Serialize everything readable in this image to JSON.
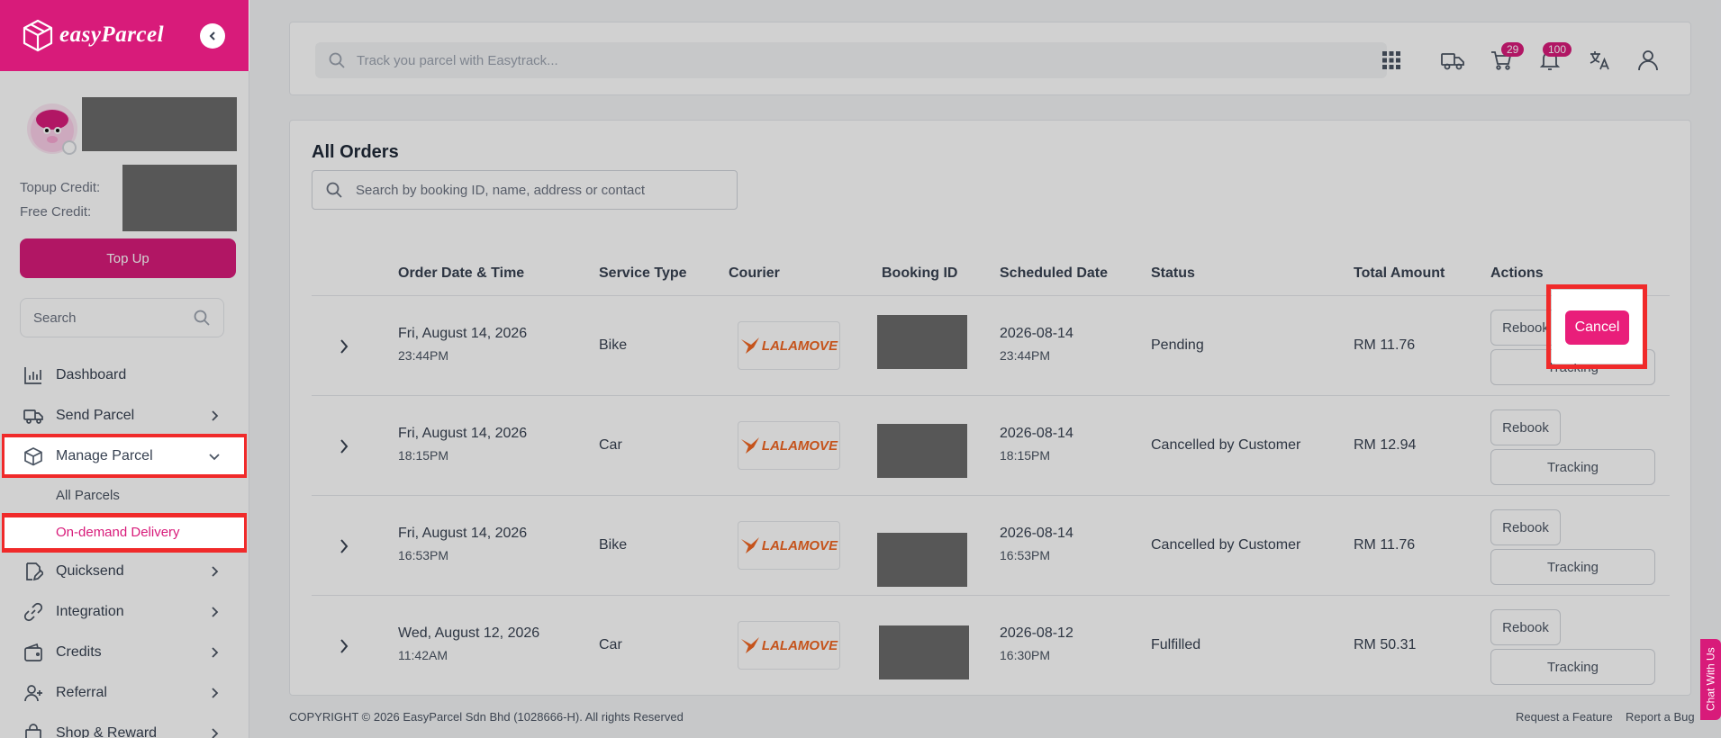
{
  "brand": {
    "name": "easyParcel"
  },
  "sidebar": {
    "topup_credit_label": "Topup Credit:",
    "free_credit_label": "Free Credit:",
    "topup_button": "Top Up",
    "search_placeholder": "Search",
    "items": [
      {
        "label": "Dashboard",
        "icon": "chart-icon"
      },
      {
        "label": "Send Parcel",
        "icon": "truck-icon"
      },
      {
        "label": "Manage Parcel",
        "icon": "box-icon"
      },
      {
        "label": "Quicksend",
        "icon": "edit-icon"
      },
      {
        "label": "Integration",
        "icon": "link-icon"
      },
      {
        "label": "Credits",
        "icon": "wallet-icon"
      },
      {
        "label": "Referral",
        "icon": "user-plus-icon"
      },
      {
        "label": "Shop & Reward",
        "icon": "shopping-bag-icon"
      }
    ],
    "sub_items": [
      {
        "label": "All Parcels"
      },
      {
        "label": "On-demand Delivery"
      }
    ]
  },
  "topbar": {
    "track_placeholder": "Track you parcel with Easytrack...",
    "cart_count": "29",
    "notification_count": "100"
  },
  "orders": {
    "title": "All Orders",
    "search_placeholder": "Search by booking ID, name, address or contact",
    "columns": [
      "Order Date & Time",
      "Service Type",
      "Courier",
      "Booking ID",
      "Scheduled Date",
      "Status",
      "Total Amount",
      "Actions"
    ],
    "rows": [
      {
        "date": "Fri, August 14, 2026",
        "time": "23:44PM",
        "service": "Bike",
        "courier": "LALAMOVE",
        "sched_date": "2026-08-14",
        "sched_time": "23:44PM",
        "status": "Pending",
        "amount": "RM 11.76"
      },
      {
        "date": "Fri, August 14, 2026",
        "time": "18:15PM",
        "service": "Car",
        "courier": "LALAMOVE",
        "sched_date": "2026-08-14",
        "sched_time": "18:15PM",
        "status": "Cancelled by Customer",
        "amount": "RM 12.94"
      },
      {
        "date": "Fri, August 14, 2026",
        "time": "16:53PM",
        "service": "Bike",
        "courier": "LALAMOVE",
        "sched_date": "2026-08-14",
        "sched_time": "16:53PM",
        "status": "Cancelled by Customer",
        "amount": "RM 11.76"
      },
      {
        "date": "Wed, August 12, 2026",
        "time": "11:42AM",
        "service": "Car",
        "courier": "LALAMOVE",
        "sched_date": "2026-08-12",
        "sched_time": "16:30PM",
        "status": "Fulfilled",
        "amount": "RM 50.31"
      }
    ],
    "rebook_label": "Rebook",
    "tracking_label": "Tracking",
    "cancel_label": "Cancel"
  },
  "footer": {
    "copyright": "COPYRIGHT © 2026 EasyParcel Sdn Bhd (1028666-H). All rights Reserved",
    "request_feature": "Request a Feature",
    "report_bug": "Report a Bug"
  },
  "chat": {
    "label": "Chat With Us"
  },
  "colors": {
    "brand": "#d81b7a",
    "highlight": "#f02a2a",
    "lalamove": "#f16622"
  }
}
